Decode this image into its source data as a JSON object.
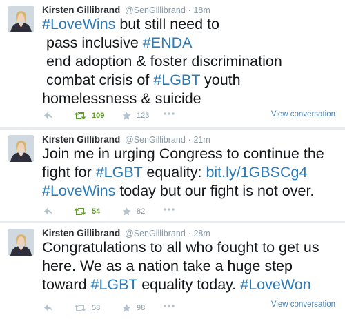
{
  "colors": {
    "hashtag": "#2b7bb9",
    "retweeted": "#609928",
    "meta": "#8899a6",
    "background": "#e6ecf0"
  },
  "tweets": [
    {
      "fullname": "Kirsten Gillibrand",
      "handle": "@SenGillibrand",
      "separator": "·",
      "time": "18m",
      "lines": [
        [
          {
            "t": "#LoveWins",
            "h": true
          },
          {
            "t": " but still need to"
          }
        ],
        [
          {
            "t": " pass inclusive "
          },
          {
            "t": "#ENDA",
            "h": true
          }
        ],
        [
          {
            "t": " end adoption & foster discrimination"
          }
        ],
        [
          {
            "t": " combat crisis of "
          },
          {
            "t": "#LGBT",
            "h": true
          },
          {
            "t": " youth"
          }
        ],
        [
          {
            "t": "homelessness & suicide"
          }
        ]
      ],
      "retweets": "109",
      "favorites": "123",
      "retweeted": true,
      "view_conversation": "View conversation"
    },
    {
      "fullname": "Kirsten Gillibrand",
      "handle": "@SenGillibrand",
      "separator": "·",
      "time": "21m",
      "lines": [
        [
          {
            "t": "Join me in urging Congress to continue the"
          }
        ],
        [
          {
            "t": "fight for "
          },
          {
            "t": "#LGBT",
            "h": true
          },
          {
            "t": " equality: "
          },
          {
            "t": "bit.ly/1GBSCg4",
            "h": true
          }
        ],
        [
          {
            "t": "#LoveWins",
            "h": true
          },
          {
            "t": " today but our fight is not over."
          }
        ]
      ],
      "retweets": "54",
      "favorites": "82",
      "retweeted": true,
      "view_conversation": ""
    },
    {
      "fullname": "Kirsten Gillibrand",
      "handle": "@SenGillibrand",
      "separator": "·",
      "time": "28m",
      "lines": [
        [
          {
            "t": "Congratulations to all who fought to get us"
          }
        ],
        [
          {
            "t": "here. We as a nation take a huge step"
          }
        ],
        [
          {
            "t": "toward "
          },
          {
            "t": "#LGBT",
            "h": true
          },
          {
            "t": " equality today. "
          },
          {
            "t": "#LoveWon",
            "h": true
          }
        ]
      ],
      "retweets": "58",
      "favorites": "98",
      "retweeted": false,
      "view_conversation": "View conversation"
    }
  ]
}
